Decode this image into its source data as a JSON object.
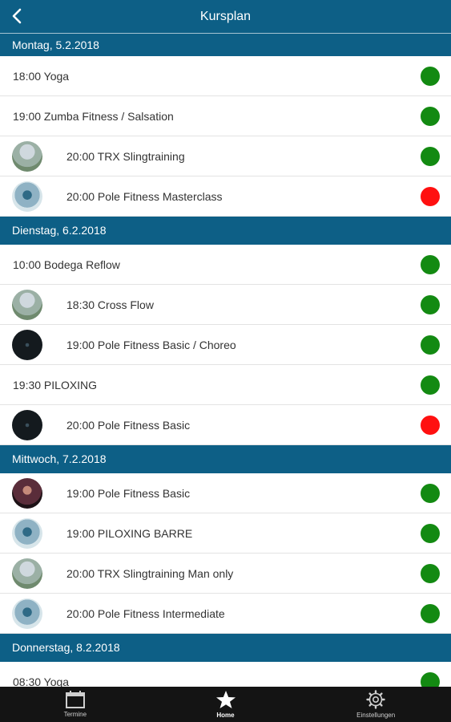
{
  "header": {
    "title": "Kursplan"
  },
  "colors": {
    "primary": "#0d5f86",
    "open": "#138a12",
    "full": "#ff1010"
  },
  "days": [
    {
      "date": "Montag, 5.2.2018",
      "courses": [
        {
          "label": "18:00 Yoga",
          "avatar": null,
          "status": "open"
        },
        {
          "label": "19:00 Zumba Fitness / Salsation",
          "avatar": null,
          "status": "open"
        },
        {
          "label": "20:00 TRX Slingtraining",
          "avatar": "av1",
          "status": "open"
        },
        {
          "label": "20:00 Pole Fitness Masterclass",
          "avatar": "av2",
          "status": "full"
        }
      ]
    },
    {
      "date": "Dienstag, 6.2.2018",
      "courses": [
        {
          "label": "10:00 Bodega Reflow",
          "avatar": null,
          "status": "open"
        },
        {
          "label": "18:30 Cross Flow",
          "avatar": "av1",
          "status": "open"
        },
        {
          "label": "19:00 Pole Fitness Basic / Choreo",
          "avatar": "av3",
          "status": "open"
        },
        {
          "label": "19:30 PILOXING",
          "avatar": null,
          "status": "open"
        },
        {
          "label": "20:00 Pole Fitness Basic",
          "avatar": "av3",
          "status": "full"
        }
      ]
    },
    {
      "date": "Mittwoch, 7.2.2018",
      "courses": [
        {
          "label": "19:00 Pole Fitness Basic",
          "avatar": "av4",
          "status": "open"
        },
        {
          "label": "19:00 PILOXING BARRE",
          "avatar": "av2",
          "status": "open"
        },
        {
          "label": "20:00 TRX Slingtraining Man only",
          "avatar": "av1",
          "status": "open"
        },
        {
          "label": "20:00 Pole Fitness Intermediate",
          "avatar": "av2",
          "status": "open"
        }
      ]
    },
    {
      "date": "Donnerstag, 8.2.2018",
      "courses": [
        {
          "label": "08:30 Yoga",
          "avatar": null,
          "status": "open"
        }
      ]
    }
  ],
  "tabs": [
    {
      "label": "Termine",
      "icon": "calendar-icon",
      "active": false
    },
    {
      "label": "Home",
      "icon": "star-icon",
      "active": true
    },
    {
      "label": "Einstellungen",
      "icon": "gear-icon",
      "active": false
    }
  ]
}
